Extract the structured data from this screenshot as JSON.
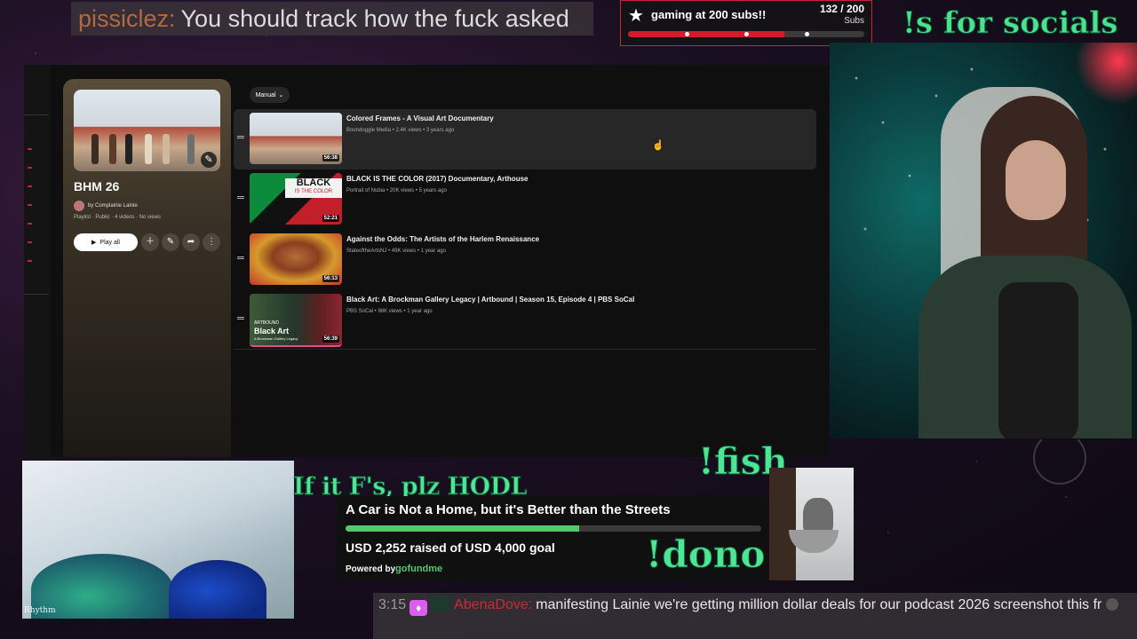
{
  "top_chat": {
    "user": "pissiclez:",
    "message": "You should track how the fuck asked"
  },
  "sub_goal": {
    "title": "gaming at 200 subs!!",
    "count": "132 / 200",
    "unit": "Subs",
    "progress": 0.66,
    "accent": "#d8192d",
    "icon": "star-icon"
  },
  "socials_text": "!s for socials :)",
  "youtube": {
    "sort_label": "Manual",
    "playlist": {
      "title": "BHM 26",
      "owner": "by Complainie Lainie",
      "meta": "Playlist · Public · 4 videos · No views",
      "play_all": "Play all"
    },
    "videos": [
      {
        "title": "Colored Frames - A Visual Art Documentary",
        "meta": "Boondoggle Media • 2.4K views • 3 years ago",
        "duration": "56:38"
      },
      {
        "title": "BLACK IS THE COLOR (2017) Documentary, Arthouse",
        "meta": "Portrait of Nubia • 20K views • 5 years ago",
        "duration": "52:21",
        "thumb_text_1": "BLACK",
        "thumb_text_2": "IS THE COLOR"
      },
      {
        "title": "Against the Odds: The Artists of the Harlem Renaissance",
        "meta": "StateoftheArtsNJ • 49K views • 1 year ago",
        "duration": "56:13"
      },
      {
        "title": "Black Art: A Brockman Gallery Legacy | Artbound | Season 15, Episode 4 | PBS SoCal",
        "meta": "PBS SoCal • 98K views • 1 year ago",
        "duration": "56:39",
        "thumb_text_1": "ARTBOUND",
        "thumb_text_2": "Black Art",
        "thumb_text_3": "A Brockman Gallery Legacy"
      }
    ]
  },
  "overlay_text": {
    "hodl": "If it F's, plz HODL",
    "fish": "!fish",
    "dono": "!dono"
  },
  "fundraiser": {
    "title": "A Car is Not a Home, but it's Better than the Streets",
    "raised": "USD 2,252 raised of USD 4,000 goal",
    "progress": 0.563,
    "powered": "Powered by",
    "brand": "gofundme"
  },
  "peacock_logo": "Rhythm",
  "bottom_chat": {
    "time": "3:15",
    "user": "AbenaDove:",
    "message": "manifesting Lainie we're getting million dollar deals for our podcast 2026 screenshot this fr"
  }
}
